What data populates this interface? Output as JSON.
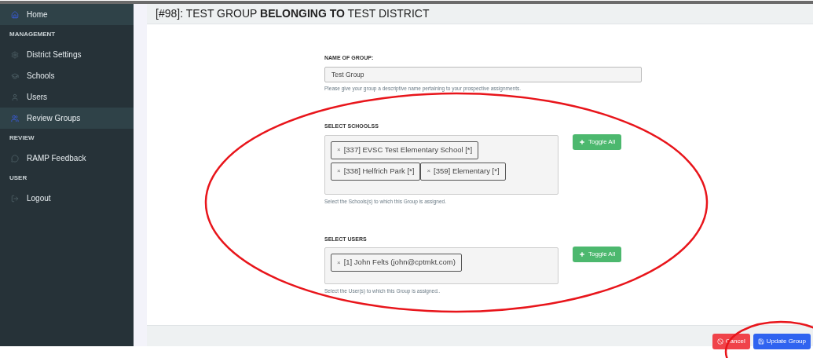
{
  "sidebar": {
    "items": [
      {
        "kind": "item",
        "label": "Home",
        "selected": true
      },
      {
        "kind": "heading",
        "label": "MANAGEMENT"
      },
      {
        "kind": "item",
        "label": "District Settings",
        "selected": false
      },
      {
        "kind": "item",
        "label": "Schools",
        "selected": false
      },
      {
        "kind": "item",
        "label": "Users",
        "selected": false
      },
      {
        "kind": "item",
        "label": "Review Groups",
        "selected": true
      },
      {
        "kind": "heading",
        "label": "REVIEW"
      },
      {
        "kind": "item",
        "label": "RAMP Feedback",
        "selected": false
      },
      {
        "kind": "heading",
        "label": "USER"
      },
      {
        "kind": "item",
        "label": "Logout",
        "selected": false
      }
    ]
  },
  "page": {
    "title": "[#98]: TEST GROUP **BELONGING TO** TEST DISTRICT"
  },
  "form": {
    "name_field": {
      "label": "NAME OF GROUP:",
      "value": "Test Group",
      "help": "Please give your group a descriptive name pertaining to your prospective assignments."
    },
    "selects": [
      {
        "label": "SELECT SCHOOLSS",
        "chips": [
          {
            "remove": "×",
            "text": "[337] EVSC Test Elementary School [*]"
          },
          {
            "remove": "×",
            "text": "[338] Helfrich Park [*]"
          },
          {
            "remove": "×",
            "text": "[359] Elementary [*]"
          }
        ],
        "toggle": "Toggle All",
        "help": "Select the Schools(s) to which this Group is assigned."
      },
      {
        "label": "SELECT USERS",
        "chips": [
          {
            "remove": "×",
            "text": "[1] John Felts (john@cptmkt.com)"
          }
        ],
        "toggle": "Toggle All",
        "help": "Select the User(s) to which this Group is assigned.."
      }
    ]
  },
  "footer": {
    "buttons": [
      {
        "kind": "cancel",
        "label": "Cancel"
      },
      {
        "kind": "primary",
        "label": "Update Group"
      }
    ]
  }
}
